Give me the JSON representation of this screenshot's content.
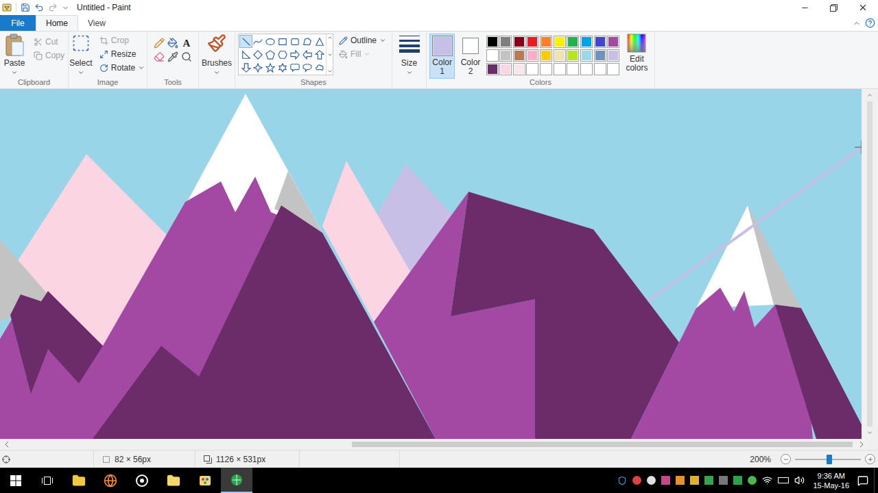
{
  "window": {
    "title": "Untitled - Paint"
  },
  "tabs": [
    {
      "label": "File",
      "selected": false
    },
    {
      "label": "Home",
      "selected": true
    },
    {
      "label": "View",
      "selected": false
    }
  ],
  "clipboard": {
    "label": "Clipboard",
    "paste": "Paste",
    "cut": {
      "label": "Cut",
      "disabled": true
    },
    "copy": {
      "label": "Copy",
      "disabled": true
    }
  },
  "image": {
    "label": "Image",
    "select": "Select",
    "crop": {
      "label": "Crop",
      "disabled": true
    },
    "resize": {
      "label": "Resize",
      "disabled": false
    },
    "rotate": {
      "label": "Rotate",
      "disabled": false
    }
  },
  "tools": {
    "label": "Tools",
    "text_tool": "A"
  },
  "brushes": {
    "label": "Brushes"
  },
  "shapes": {
    "label": "Shapes",
    "gallery": [
      {
        "selected": true
      },
      {
        "selected": false
      },
      {
        "selected": false
      },
      {
        "selected": false
      },
      {
        "selected": false
      },
      {
        "selected": false
      },
      {
        "selected": false
      },
      {
        "selected": false
      },
      {
        "selected": false
      },
      {
        "selected": false
      },
      {
        "selected": false
      },
      {
        "selected": false
      },
      {
        "selected": false
      },
      {
        "selected": false
      },
      {
        "selected": false
      },
      {
        "selected": false
      },
      {
        "selected": false
      },
      {
        "selected": false
      },
      {
        "selected": false
      },
      {
        "selected": false
      },
      {
        "selected": false
      }
    ],
    "outline": {
      "label": "Outline",
      "disabled": false
    },
    "fill": {
      "label": "Fill",
      "disabled": true
    }
  },
  "size": {
    "label": "Size"
  },
  "colors": {
    "label": "Colors",
    "color1": {
      "label": "Color",
      "number": "1",
      "color": "#c8bfe7",
      "selected": true
    },
    "color2": {
      "label": "Color",
      "number": "2",
      "color": "#ffffff",
      "selected": false
    },
    "palette": [
      {
        "color": "#000000"
      },
      {
        "color": "#7f7f7f"
      },
      {
        "color": "#880015"
      },
      {
        "color": "#ed1c24"
      },
      {
        "color": "#ff7f27"
      },
      {
        "color": "#fff200"
      },
      {
        "color": "#22b14c"
      },
      {
        "color": "#00a2e8"
      },
      {
        "color": "#3f48cc"
      },
      {
        "color": "#a349a4"
      },
      {
        "color": "#ffffff"
      },
      {
        "color": "#c3c3c3"
      },
      {
        "color": "#b97a57"
      },
      {
        "color": "#ffaec9"
      },
      {
        "color": "#ffc90e"
      },
      {
        "color": "#efe4b0"
      },
      {
        "color": "#b5e61d"
      },
      {
        "color": "#99d9ea"
      },
      {
        "color": "#7092be"
      },
      {
        "color": "#c8bfe7"
      },
      {
        "color": "#6b2c69"
      },
      {
        "color": "#fbd5e1"
      },
      {
        "color": "#fce4ec"
      },
      {
        "color": "#ffffff"
      },
      {
        "color": "#ffffff"
      },
      {
        "color": "#ffffff"
      },
      {
        "color": "#ffffff"
      },
      {
        "color": "#ffffff"
      },
      {
        "color": "#ffffff"
      },
      {
        "color": "#ffffff"
      }
    ],
    "edit": "Edit colors"
  },
  "status_bar": {
    "selection": "82 × 56px",
    "canvas_size": "1126 × 531px",
    "zoom": "200%",
    "zoom_level": 0.52
  },
  "taskbar": {
    "apps": [
      {
        "selected": false
      },
      {
        "selected": false
      },
      {
        "selected": false
      },
      {
        "selected": false
      },
      {
        "selected": false
      },
      {
        "selected": true
      },
      {
        "selected": false
      }
    ],
    "time": "9:36 AM",
    "date": "15-May-16"
  }
}
